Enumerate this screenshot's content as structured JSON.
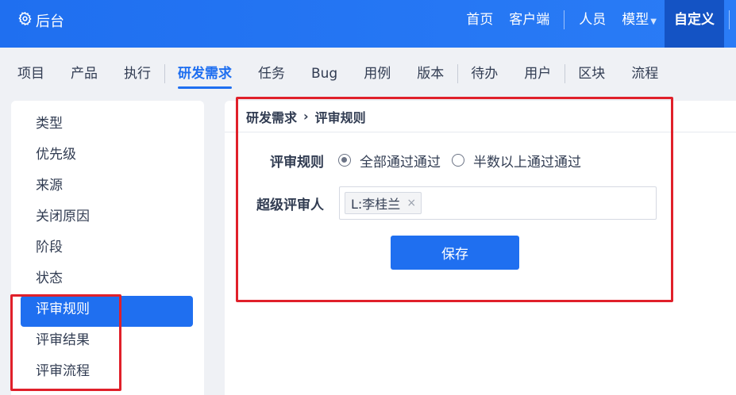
{
  "header": {
    "brand_label": "后台",
    "nav": [
      {
        "label": "首页"
      },
      {
        "label": "客户端"
      },
      {
        "label": "人员"
      },
      {
        "label": "模型"
      },
      {
        "label": "自定义"
      }
    ]
  },
  "subnav": {
    "tabs": [
      {
        "label": "项目"
      },
      {
        "label": "产品"
      },
      {
        "label": "执行"
      },
      {
        "label": "研发需求"
      },
      {
        "label": "任务"
      },
      {
        "label": "Bug"
      },
      {
        "label": "用例"
      },
      {
        "label": "版本"
      },
      {
        "label": "待办"
      },
      {
        "label": "用户"
      },
      {
        "label": "区块"
      },
      {
        "label": "流程"
      }
    ]
  },
  "sidebar": {
    "items": [
      {
        "label": "类型"
      },
      {
        "label": "优先级"
      },
      {
        "label": "来源"
      },
      {
        "label": "关闭原因"
      },
      {
        "label": "阶段"
      },
      {
        "label": "状态"
      },
      {
        "label": "评审规则"
      },
      {
        "label": "评审结果"
      },
      {
        "label": "评审流程"
      }
    ]
  },
  "main": {
    "breadcrumb": {
      "parent": "研发需求",
      "separator": "›",
      "current": "评审规则"
    },
    "review_rule": {
      "label": "评审规则",
      "options": [
        {
          "label": "全部通过通过",
          "checked": true
        },
        {
          "label": "半数以上通过通过",
          "checked": false
        }
      ]
    },
    "super_reviewer": {
      "label": "超级评审人",
      "chips": [
        {
          "label": "L:李桂兰",
          "remove": "×"
        }
      ]
    },
    "save_label": "保存"
  },
  "colors": {
    "accent": "#1f6ff0",
    "header_active": "#1453c4",
    "annotation": "#e0202a"
  }
}
